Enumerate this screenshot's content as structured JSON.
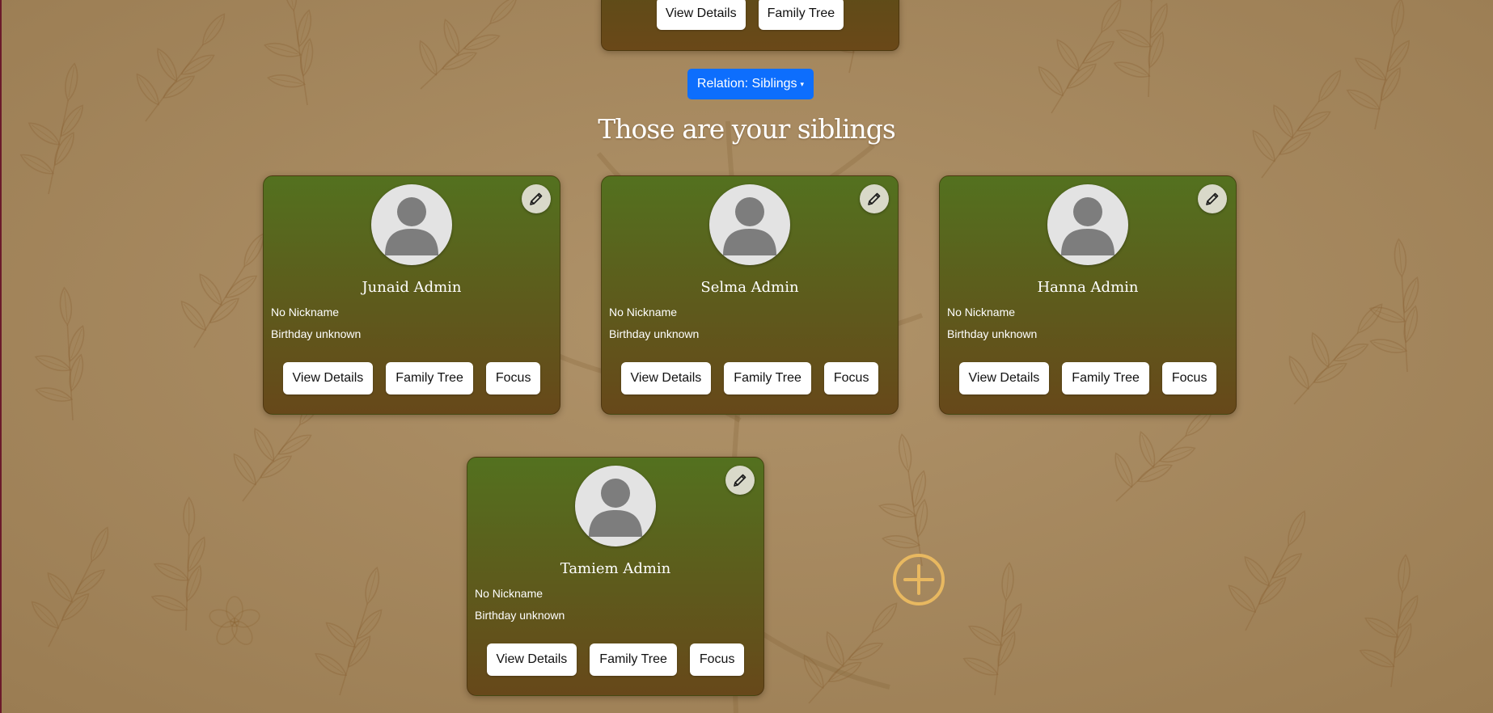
{
  "top_card": {
    "view_details_label": "View Details",
    "family_tree_label": "Family Tree"
  },
  "relation_dropdown": {
    "label": "Relation: Siblings",
    "caret": "▾"
  },
  "heading": "Those are your siblings",
  "siblings": [
    {
      "name": "Junaid Admin",
      "nickname": "No Nickname",
      "birthday": "Birthday unknown",
      "view_details_label": "View Details",
      "family_tree_label": "Family Tree",
      "focus_label": "Focus"
    },
    {
      "name": "Selma Admin",
      "nickname": "No Nickname",
      "birthday": "Birthday unknown",
      "view_details_label": "View Details",
      "family_tree_label": "Family Tree",
      "focus_label": "Focus"
    },
    {
      "name": "Hanna Admin",
      "nickname": "No Nickname",
      "birthday": "Birthday unknown",
      "view_details_label": "View Details",
      "family_tree_label": "Family Tree",
      "focus_label": "Focus"
    },
    {
      "name": "Tamiem Admin",
      "nickname": "No Nickname",
      "birthday": "Birthday unknown",
      "view_details_label": "View Details",
      "family_tree_label": "Family Tree",
      "focus_label": "Focus"
    }
  ],
  "icons": {
    "avatar": "user-silhouette-icon",
    "edit": "pencil-icon",
    "add": "plus-circle-icon"
  },
  "colors": {
    "accent_blue": "#0d6efd",
    "card_top": "#53711f",
    "card_bottom": "#67481a",
    "add_icon": "#e8b860",
    "background": "#a88b62"
  }
}
